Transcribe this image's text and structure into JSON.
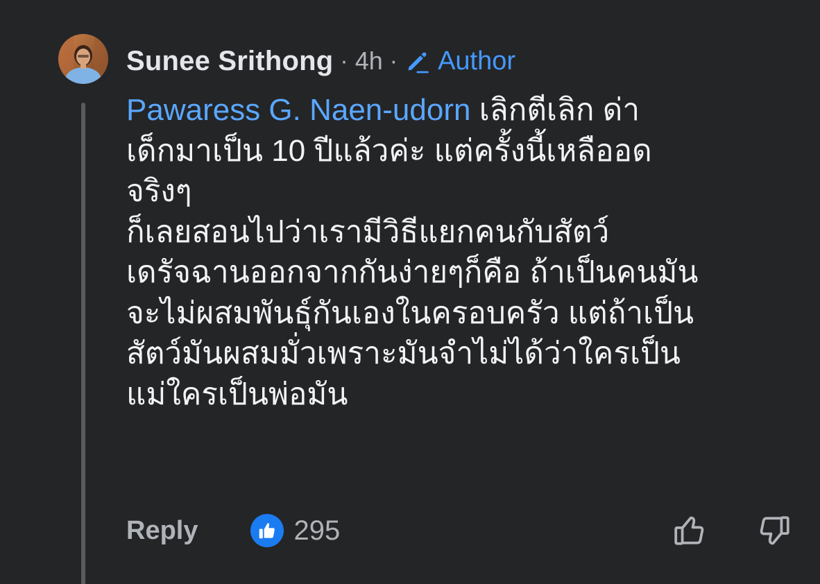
{
  "comment": {
    "author": "Sunee Srithong",
    "separator": "·",
    "time": "4h",
    "badge": "Author",
    "mention": "Pawaress G. Naen-udorn",
    "lines": [
      "เลิกตีเลิก ด่า",
      "เด็กมาเป็น 10 ปีแล้วค่ะ แต่ครั้งนี้เหลืออด",
      "จริงๆ",
      "ก็เลยสอนไปว่าเรามีวิธีแยกคนกับสัตว์",
      "เดรัจฉานออกจากกันง่ายๆก็คือ ถ้าเป็นคนมัน",
      "จะไม่ผสมพันธุ์กันเองในครอบครัว แต่ถ้าเป็น",
      "สัตว์มันผสมมั่วเพราะมันจำไม่ได้ว่าใครเป็น",
      "แม่ใครเป็นพ่อมัน"
    ]
  },
  "actions": {
    "reply_label": "Reply",
    "like_count": "295"
  },
  "icons": {
    "avatar": "avatar",
    "badge": "pencil-icon",
    "reaction": "like-icon",
    "upvote": "thumbs-up-outline-icon",
    "downvote": "thumbs-down-outline-icon"
  },
  "colors": {
    "background": "#242527",
    "primary_text": "#e4e6eb",
    "secondary_text": "#b0b3b8",
    "link": "#5aa7ff",
    "like_blue": "#1b7cf2"
  }
}
